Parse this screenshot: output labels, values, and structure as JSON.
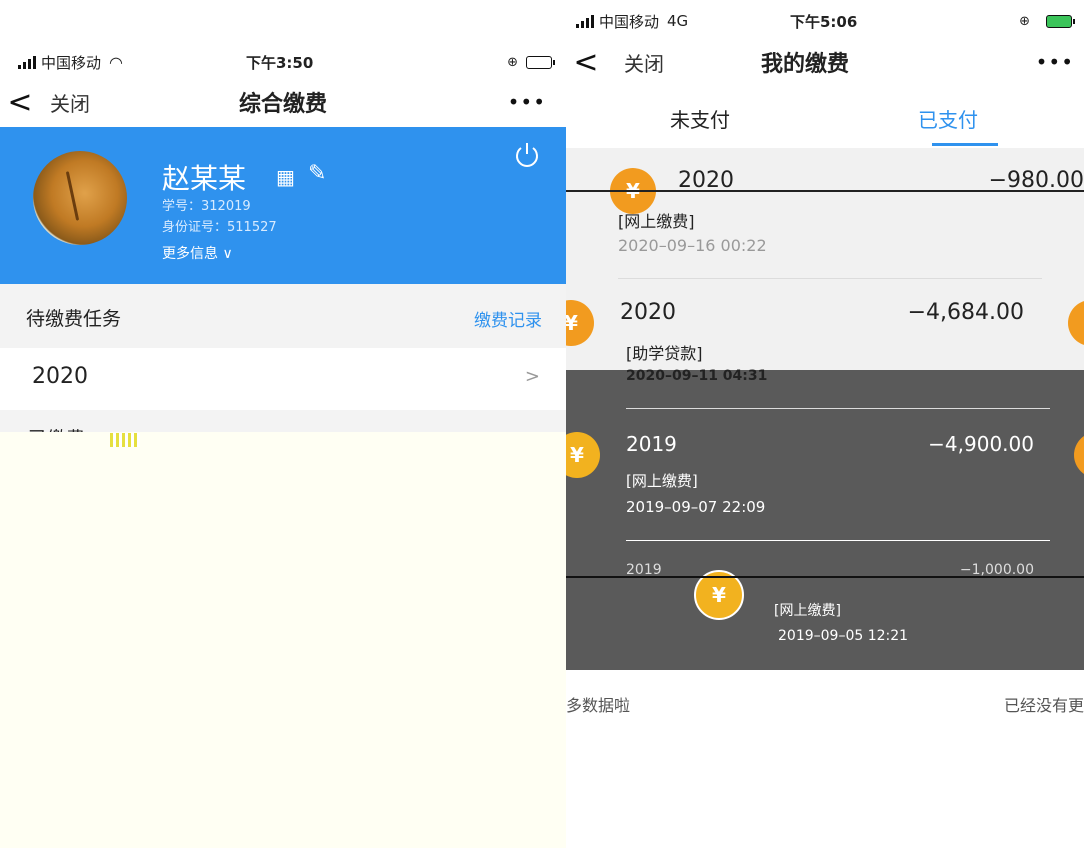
{
  "left": {
    "status": {
      "carrier": "中国移动",
      "time": "下午3:50"
    },
    "nav": {
      "back": "<",
      "close": "关闭",
      "title": "综合缴费",
      "more": "•••"
    },
    "profile": {
      "name": "赵某某",
      "qr_icon": "qr-code-icon",
      "edit_icon": "pencil-icon",
      "student_id": "学号：312019",
      "id_card": "身份证号：511527",
      "more_info": "更多信息 ∨",
      "card_color": "#2f92ee"
    },
    "pending": {
      "title": "待缴费任务",
      "record_link": "缴费记录"
    },
    "pending_items": [
      {
        "year": "2020",
        "chevron": ">"
      }
    ],
    "paid": {
      "title": "已缴费"
    }
  },
  "right": {
    "status": {
      "carrier": "中国移动",
      "network": "4G",
      "time": "下午5:06"
    },
    "nav": {
      "back": "<",
      "close": "关闭",
      "title": "我的缴费",
      "more": "•••"
    },
    "tabs": {
      "unpaid": "未支付",
      "paid": "已支付",
      "active": "paid",
      "accent": "#2f92ee"
    },
    "records": [
      {
        "year": "2020",
        "amount": "−980.00",
        "type": "[网上缴费]",
        "time": "2020–09–16 00:22"
      },
      {
        "year": "2020",
        "amount": "−4,684.00",
        "type": "[助学贷款]",
        "time": "2020–09–11 04:31"
      },
      {
        "year": "2019",
        "amount": "−4,900.00",
        "type": "[网上缴费]",
        "time": "2019–09–07 22:09"
      },
      {
        "year": "2019",
        "amount": "−1,000.00",
        "type": "[网上缴费]",
        "time": "2019–09–05 12:21"
      }
    ],
    "footer": {
      "end_text_left": "多数据啦",
      "end_text_right": "已经没有更"
    }
  }
}
